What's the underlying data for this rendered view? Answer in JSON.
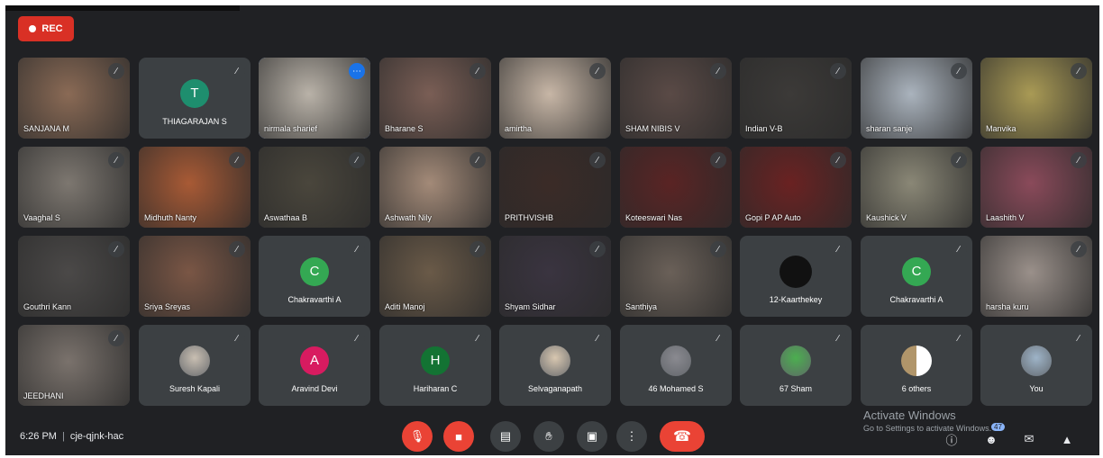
{
  "recording": {
    "label": "REC"
  },
  "participants": [
    {
      "name": "SANJANA M",
      "type": "video",
      "bg": "#8a6a55"
    },
    {
      "name": "THIAGARAJAN S",
      "type": "initial",
      "initial": "T",
      "color": "#1e8e6e"
    },
    {
      "name": "nirmala sharief",
      "type": "video",
      "bg": "#b9b2a8",
      "selected": true,
      "menu": true
    },
    {
      "name": "Bharane S",
      "type": "video",
      "bg": "#7a5e55"
    },
    {
      "name": "amirtha",
      "type": "video",
      "bg": "#c7b6a6"
    },
    {
      "name": "SHAM NIBIS V",
      "type": "video",
      "bg": "#5a4a46"
    },
    {
      "name": "Indian V-B",
      "type": "video",
      "bg": "#3c3a38"
    },
    {
      "name": "sharan sanje",
      "type": "video",
      "bg": "#aab3bd"
    },
    {
      "name": "Manvika",
      "type": "video",
      "bg": "#a99a55"
    },
    {
      "name": "Vaaghal S",
      "type": "video",
      "bg": "#7d7770"
    },
    {
      "name": "Midhuth Nanty",
      "type": "video",
      "bg": "#a85a35"
    },
    {
      "name": "Aswathaa B",
      "type": "video",
      "bg": "#4a463c"
    },
    {
      "name": "Ashwath Nily",
      "type": "video",
      "bg": "#a38a78"
    },
    {
      "name": "PRITHVISHB",
      "type": "video",
      "bg": "#3b2b27"
    },
    {
      "name": "Koteeswari Nas",
      "type": "video",
      "bg": "#5a2424"
    },
    {
      "name": "Gopi P AP Auto",
      "type": "video",
      "bg": "#6a2222"
    },
    {
      "name": "Kaushick V",
      "type": "video",
      "bg": "#8a8776"
    },
    {
      "name": "Laashith V",
      "type": "video",
      "bg": "#8a4a5a"
    },
    {
      "name": "Gouthri Kann",
      "type": "video",
      "bg": "#4b4948"
    },
    {
      "name": "Sriya Sreyas",
      "type": "video",
      "bg": "#7a5645"
    },
    {
      "name": "Chakravarthi A",
      "type": "initial",
      "initial": "C",
      "color": "#34a853"
    },
    {
      "name": "Aditi Manoj",
      "type": "video",
      "bg": "#6a5a48"
    },
    {
      "name": "Shyam Sidhar",
      "type": "video",
      "bg": "#3a3440"
    },
    {
      "name": "Santhiya",
      "type": "video",
      "bg": "#6a6058"
    },
    {
      "name": "12-Kaarthekey",
      "type": "logo",
      "color": "#111111"
    },
    {
      "name": "Chakravarthi A",
      "type": "initial",
      "initial": "C",
      "color": "#34a853"
    },
    {
      "name": "harsha kuru",
      "type": "video",
      "bg": "#9a908a"
    },
    {
      "name": "JEEDHANI",
      "type": "video",
      "bg": "#7a726c"
    },
    {
      "name": "Suresh Kapali",
      "type": "photo",
      "color": "#c9bfb2"
    },
    {
      "name": "Aravind Devi",
      "type": "initial",
      "initial": "A",
      "color": "#d81b60"
    },
    {
      "name": "Hariharan C",
      "type": "initial",
      "initial": "H",
      "color": "#137333"
    },
    {
      "name": "Selvaganapath",
      "type": "photo",
      "color": "#d8c7b0"
    },
    {
      "name": "46 Mohamed S",
      "type": "photo",
      "color": "#8a8a90"
    },
    {
      "name": "67 Sham",
      "type": "photo",
      "color": "#4caf50"
    },
    {
      "name": "6 others",
      "type": "others",
      "color": "#b0956a"
    },
    {
      "name": "You",
      "type": "photo",
      "color": "#9eb4c8"
    }
  ],
  "footer": {
    "time": "6:26 PM",
    "separator": "|",
    "meeting_code": "cje-qjnk-hac",
    "participants_badge": "47"
  },
  "activate_windows": {
    "title": "Activate Windows",
    "subtitle": "Go to Settings to activate Windows."
  },
  "icons": {
    "mic_off": "mic-off-icon",
    "cam_off": "camera-off-icon",
    "captions": "captions-icon",
    "hand": "raise-hand-icon",
    "present": "present-icon",
    "more": "more-options-icon",
    "end": "end-call-icon",
    "info": "info-icon",
    "people": "people-icon",
    "chat": "chat-icon",
    "activities": "activities-icon"
  },
  "colors": {
    "background": "#202124",
    "tile": "#3c4043",
    "accent_red": "#ea4335",
    "select": "#8ab4f8"
  }
}
